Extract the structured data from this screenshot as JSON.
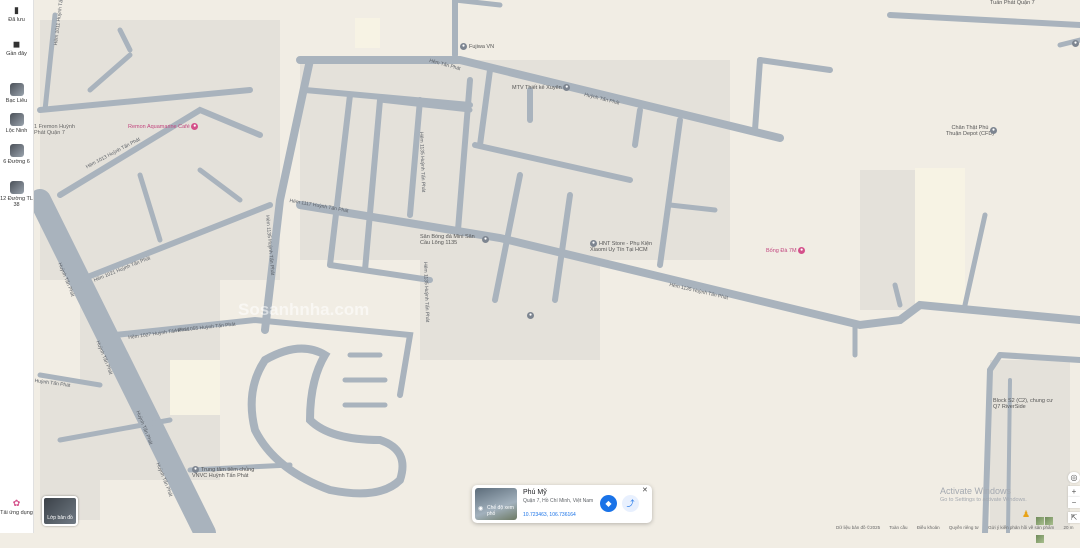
{
  "rail": {
    "items": [
      {
        "label": "Đã lưu",
        "icon": "bookmark-icon"
      },
      {
        "label": "Gần đây",
        "icon": "history-icon"
      },
      {
        "label": "Bạc Liêu",
        "icon": "place-thumbnail"
      },
      {
        "label": "Lộc Ninh",
        "icon": "place-thumbnail"
      },
      {
        "label": "6 Đường 6",
        "icon": "place-thumbnail"
      },
      {
        "label": "12 Đường TL 38",
        "icon": "place-thumbnail"
      }
    ],
    "get_app": "Tải ứng dụng",
    "layers_label": "Lớp bản đồ"
  },
  "map": {
    "pois": [
      {
        "name": "Fujiwa VN",
        "color": "#7d8590"
      },
      {
        "name": "MTV Thiết kế Xuyên",
        "color": "#7d8590"
      },
      {
        "name": "Remon Aquamarine Café",
        "color": "#d4508a"
      },
      {
        "name": "Sân Bóng đá Mini Sân Cầu Lông 1135",
        "color": "#7d8590"
      },
      {
        "name": "HNT Store - Phụ Kiện Xiaomi Uy Tín Tại HCM",
        "color": "#7d8590"
      },
      {
        "name": "Bống Đà 7M",
        "color": "#d4508a"
      },
      {
        "name": "Chân Thật Phú Thuận Depot (CFD)",
        "color": "#7d8590"
      },
      {
        "name": "Tuấn Phát Quận 7",
        "color": "#7d8590"
      },
      {
        "name": "Trung tâm tiêm chủng VNVC Huỳnh Tấn Phát",
        "color": "#7d8590"
      },
      {
        "name": "Block S2 (C2), chung cư Q7 RiverSide",
        "color": "#7d8590"
      }
    ],
    "streets": {
      "main_diag": "Huỳnh Tấn Phát",
      "h1135": "Hẻm 1135 Huỳnh Tấn Phát",
      "h1117": "Hẻm 1117 Huỳnh Tấn Phát",
      "h1135b": "Hẻm 1135 Huỳnh Tấn Phát",
      "hhtp_left": "Huỳnh Tấn Phát",
      "hhtp_left2": "Huỳnh Tấn Phát",
      "h_top": "Hẻm Tấn Phát",
      "h_top2": "Huỳnh Tấn Phát",
      "h_top3": "Huỳnh Tấn Phát",
      "h_left": "Hẻm 1021 Huỳnh Tấn Phát",
      "h_left2": "Hẻm 1055 Huỳnh Tấn Phát",
      "h_left3": "Hẻm 1027 Huỳnh Tấn Phát",
      "h_left4": "Hẻm 1011 Huỳnh Tấn Phát",
      "h_left5": "Hẻm 1013 Huỳnh Tấn Phát",
      "h_mid": "Hẻm 1135 Huỳnh Tấn Phát",
      "h_vert": "Hẻm 1135 Huỳnh Tấn Phát"
    },
    "left_partial": "1 Fremon Huỳnh\nPhát Quận 7",
    "watermark": "Sosanhnha.com"
  },
  "card": {
    "title": "Phú Mỹ",
    "subtitle": "Quận 7, Hồ Chí Minh, Việt Nam",
    "coords": "10.723463, 106.736164",
    "image_label": "Chế độ xem phố",
    "directions_icon": "directions-icon",
    "share_icon": "share-icon",
    "close_icon": "close-icon"
  },
  "controls": {
    "zoom_in": "+",
    "zoom_out": "−",
    "locate_icon": "my-location-icon",
    "expand_icon": "expand-icon"
  },
  "footer": {
    "items": [
      "Dữ liệu bản đồ ©2025",
      "Toàn cầu",
      "Điều khoản",
      "Quyền riêng tư",
      "Gửi ý kiến phản hồi về sản phẩm",
      "20 m"
    ]
  },
  "system": {
    "activate": "Activate Windows",
    "activate_sub": "Go to Settings to activate Windows."
  }
}
